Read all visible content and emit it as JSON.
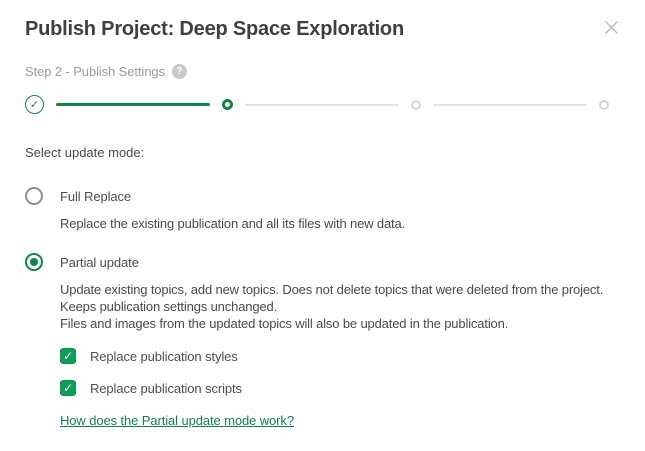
{
  "dialog": {
    "title": "Publish Project: Deep Space Exploration"
  },
  "stepper": {
    "label": "Step 2 - Publish Settings",
    "current_step": 2,
    "total_steps": 4,
    "steps": [
      {
        "index": 1,
        "state": "completed"
      },
      {
        "index": 2,
        "state": "current"
      },
      {
        "index": 3,
        "state": "upcoming"
      },
      {
        "index": 4,
        "state": "upcoming"
      }
    ]
  },
  "form": {
    "prompt": "Select update mode:",
    "options": [
      {
        "label": "Full Replace",
        "selected": false,
        "description": "Replace the existing publication and all its files with new data."
      },
      {
        "label": "Partial update",
        "selected": true,
        "description_para1": "Update existing topics, add new topics. Does not delete topics that were deleted from the project. Keeps publication settings unchanged.",
        "description_para2": "Files and images from the updated topics will also be updated in the publication."
      }
    ],
    "checkboxes": [
      {
        "label": "Replace publication styles",
        "checked": true
      },
      {
        "label": "Replace publication scripts",
        "checked": true
      }
    ],
    "link_label": "How does the Partial update mode work?"
  },
  "icons": {
    "close": "✕",
    "help": "?",
    "check": "✓"
  },
  "colors": {
    "accent_green": "#0f9c53",
    "progress_green": "#0e8743",
    "link_green": "#11824b",
    "muted_gray": "#9b9b9b",
    "text_dark": "#4a4a4a"
  }
}
